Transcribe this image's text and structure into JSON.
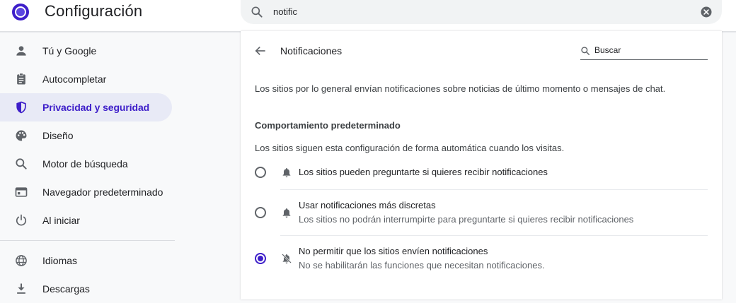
{
  "header": {
    "title": "Configuración",
    "search_value": "notific",
    "logo_icon": "chrome-settings-logo",
    "search_icon": "search-icon",
    "clear_icon": "clear-circle-icon"
  },
  "sidebar": {
    "active_color": "#3d1ec9",
    "items": [
      {
        "label": "Tú y Google",
        "icon": "person-icon"
      },
      {
        "label": "Autocompletar",
        "icon": "clipboard-icon"
      },
      {
        "label": "Privacidad y seguridad",
        "icon": "shield-icon",
        "active": true
      },
      {
        "label": "Diseño",
        "icon": "palette-icon"
      },
      {
        "label": "Motor de búsqueda",
        "icon": "search-icon"
      },
      {
        "label": "Navegador predeterminado",
        "icon": "browser-window-icon"
      },
      {
        "label": "Al iniciar",
        "icon": "power-icon"
      },
      {
        "label": "Idiomas",
        "icon": "globe-icon"
      },
      {
        "label": "Descargas",
        "icon": "download-icon"
      }
    ]
  },
  "page": {
    "title": "Notificaciones",
    "search_placeholder": "Buscar",
    "intro": "Los sitios por lo general envían notificaciones sobre noticias de último momento o mensajes de chat.",
    "section_heading": "Comportamiento predeterminado",
    "section_sub": "Los sitios siguen esta configuración de forma automática cuando los visitas.",
    "options": [
      {
        "label": "Los sitios pueden preguntarte si quieres recibir notificaciones",
        "sub": "",
        "icon": "bell-icon",
        "checked": false
      },
      {
        "label": "Usar notificaciones más discretas",
        "sub": "Los sitios no podrán interrumpirte para preguntarte si quieres recibir notificaciones",
        "icon": "bell-icon",
        "checked": false
      },
      {
        "label": "No permitir que los sitios envíen notificaciones",
        "sub": "No se habilitarán las funciones que necesitan notificaciones.",
        "icon": "bell-off-icon",
        "checked": true
      }
    ]
  }
}
